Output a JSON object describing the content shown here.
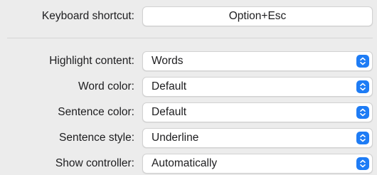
{
  "shortcut": {
    "label": "Keyboard shortcut:",
    "value": "Option+Esc"
  },
  "settings": [
    {
      "label": "Highlight content:",
      "value": "Words",
      "icon": "chevron-updown-icon"
    },
    {
      "label": "Word color:",
      "value": "Default",
      "icon": "chevron-updown-icon"
    },
    {
      "label": "Sentence color:",
      "value": "Default",
      "icon": "chevron-updown-icon"
    },
    {
      "label": "Sentence style:",
      "value": "Underline",
      "icon": "chevron-updown-icon"
    },
    {
      "label": "Show controller:",
      "value": "Automatically",
      "icon": "chevron-updown-icon"
    }
  ],
  "colors": {
    "accent": "#1e7cf5",
    "background": "#ececec"
  }
}
